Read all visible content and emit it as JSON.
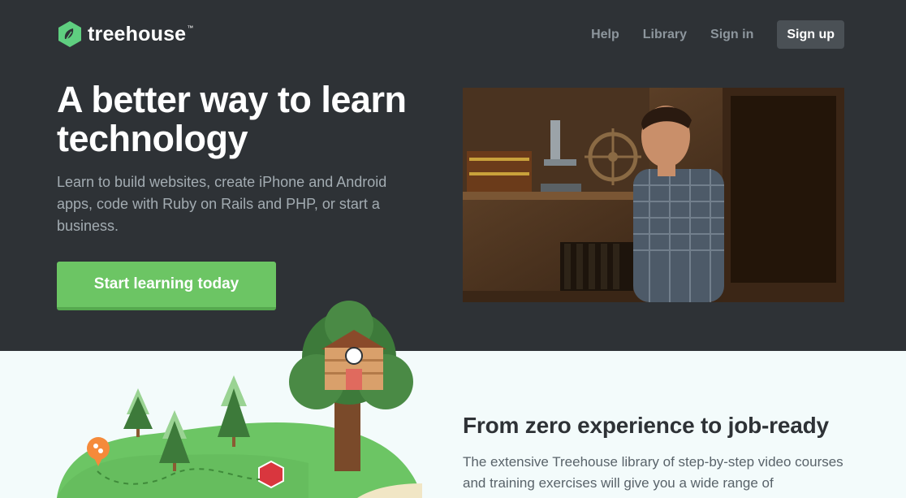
{
  "brand": {
    "name": "treehouse",
    "tm": "™",
    "color": "#5fcf80"
  },
  "nav": {
    "items": [
      {
        "label": "Help"
      },
      {
        "label": "Library"
      },
      {
        "label": "Sign in"
      }
    ],
    "signup_label": "Sign up"
  },
  "hero": {
    "headline": "A better way to learn technology",
    "subtext": "Learn to build websites, create iPhone and Android apps, code with Ruby on Rails and PHP, or start a business.",
    "cta_label": "Start learning today",
    "cta_color": "#6cc564",
    "background": "#2e3236"
  },
  "section": {
    "title": "From zero experience to job-ready",
    "text": "The extensive Treehouse library of step-by-step video courses and training exercises will give you a wide range of"
  },
  "colors": {
    "section_bg": "#f3fbfb",
    "hill": "#6cc564",
    "tree": "#3d7a3a"
  }
}
